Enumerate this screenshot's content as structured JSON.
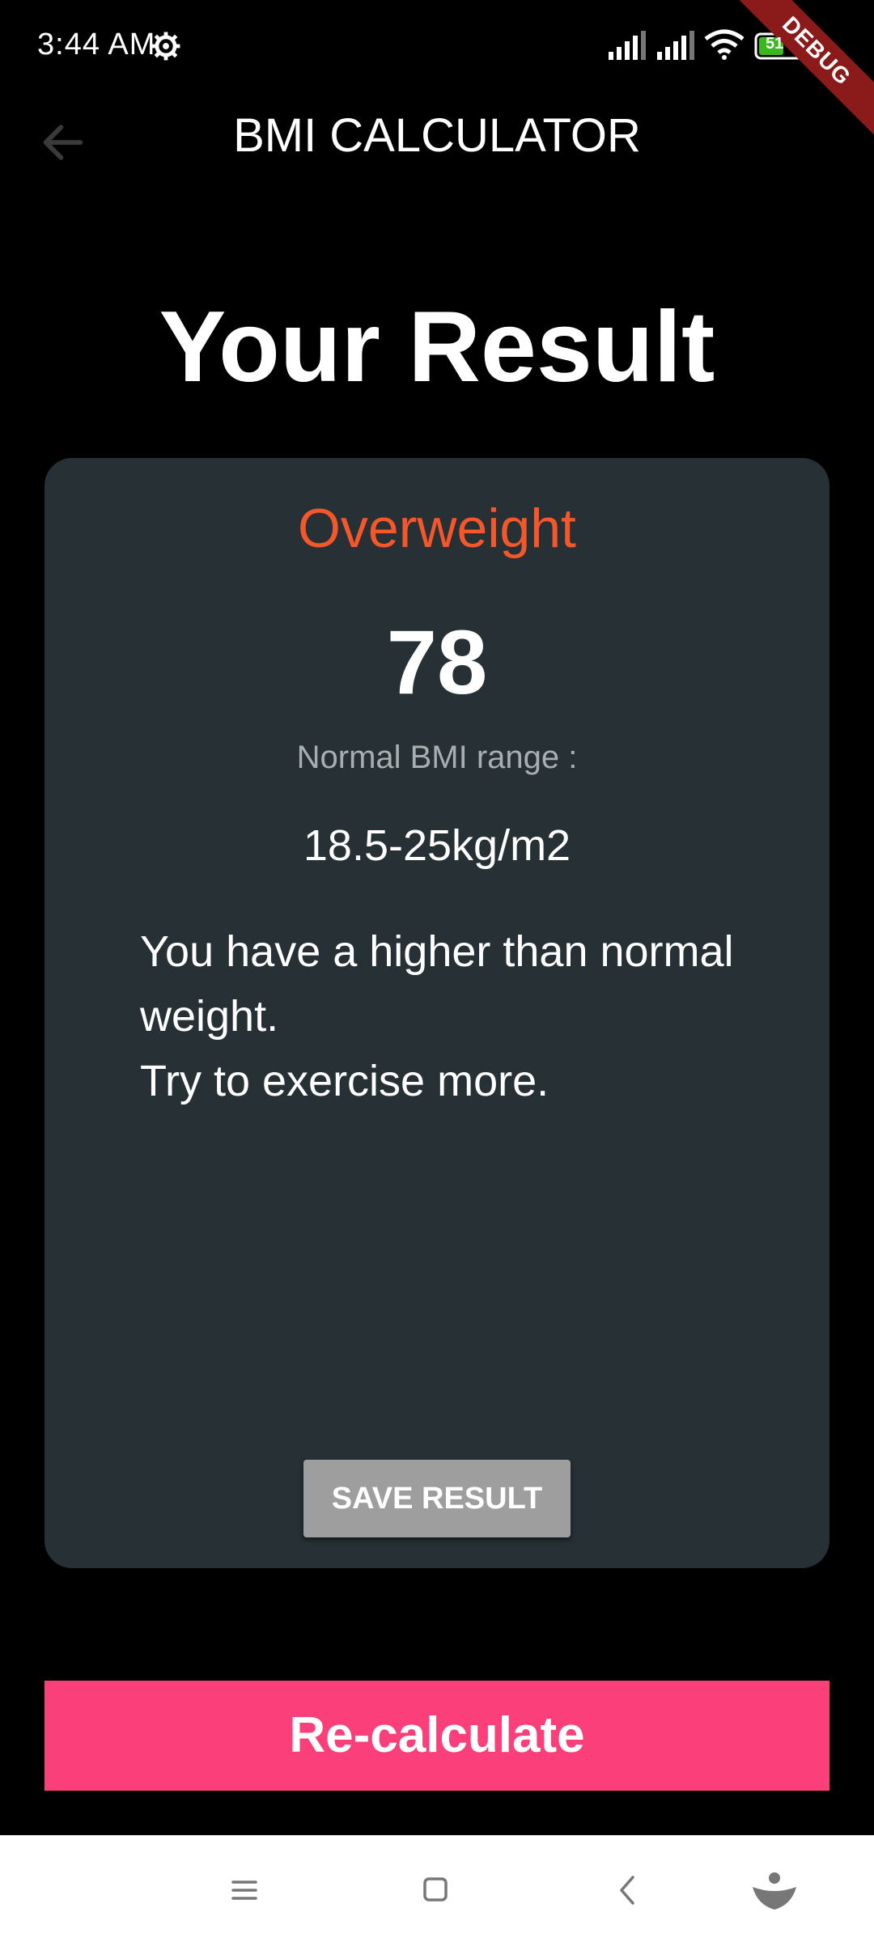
{
  "status_bar": {
    "time": "3:44 AM",
    "battery": "51",
    "icons": [
      "settings-gear-icon",
      "signal-icon",
      "signal-icon",
      "wifi-icon",
      "battery-icon"
    ]
  },
  "debug_banner": "DEBUG",
  "app_bar": {
    "title": "BMI CALCULATOR",
    "back_icon": "arrow-left-icon"
  },
  "heading": "Your Result",
  "result": {
    "status": "Overweight",
    "bmi": "78",
    "range_label": "Normal BMI range :",
    "range_value": "18.5-25kg/m2",
    "advice": "You have a higher than normal\n weight.\nTry to exercise more.",
    "save_label": "SAVE RESULT"
  },
  "recalculate_label": "Re-calculate",
  "nav_bar": {
    "icons": [
      "menu-icon",
      "home-square-icon",
      "back-chevron-icon",
      "assistant-icon"
    ]
  },
  "colors": {
    "background": "#000000",
    "card": "#263035",
    "status_text": "#f4572a",
    "accent_button": "#fa3f7a",
    "save_button": "#9e9e9e"
  }
}
